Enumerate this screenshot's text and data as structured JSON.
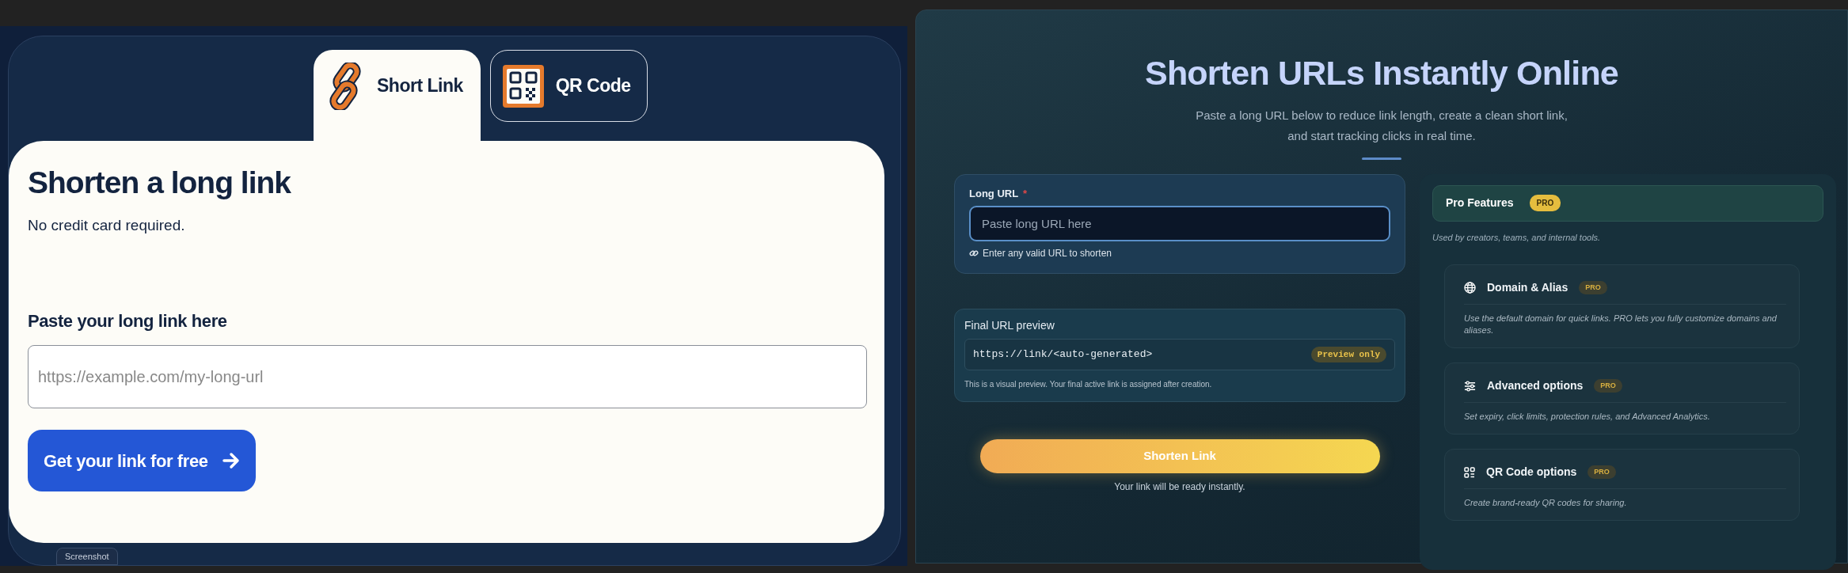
{
  "left_panel": {
    "tabs": [
      {
        "kind": "link",
        "label": "Short Link",
        "selected": true
      },
      {
        "kind": "qr",
        "label": "QR Code",
        "selected": false
      }
    ],
    "heading": "Shorten a long link",
    "subheading": "No credit card required.",
    "field_label": "Paste your long link here",
    "field": {
      "placeholder": "https://example.com/my-long-url"
    },
    "submit_button": "Get your link for free",
    "footer_chip": "Screenshot"
  },
  "right_panel": {
    "title": "Shorten URLs Instantly Online",
    "subtitle_lines": [
      "Paste a long URL below to reduce link length, create a clean short link,",
      "and start tracking clicks in real time."
    ],
    "long_url": {
      "label": "Long URL",
      "required_mark": "*",
      "placeholder": "Paste long URL here",
      "hint": "Enter any valid URL to shorten"
    },
    "preview": {
      "label": "Final URL preview",
      "value": "https://link/<auto-generated>",
      "badge": "Preview only",
      "note": "This is a visual preview. Your final active link is assigned after creation."
    },
    "shorten_button": "Shorten Link",
    "caption": "Your link will be ready instantly.",
    "pro": {
      "title": "Pro Features",
      "badge": "PRO",
      "subtitle": "Used by creators, teams, and internal tools.",
      "features": [
        {
          "kind": "globe",
          "title": "Domain & Alias",
          "badge": "PRO",
          "description": "Use the default domain for quick links. PRO lets you fully customize domains and aliases."
        },
        {
          "kind": "sliders",
          "title": "Advanced options",
          "badge": "PRO",
          "description": "Set expiry, click limits, protection rules, and Advanced Analytics."
        },
        {
          "kind": "qr",
          "title": "QR Code options",
          "badge": "PRO",
          "description": "Create brand-ready QR codes for sharing."
        }
      ]
    }
  }
}
